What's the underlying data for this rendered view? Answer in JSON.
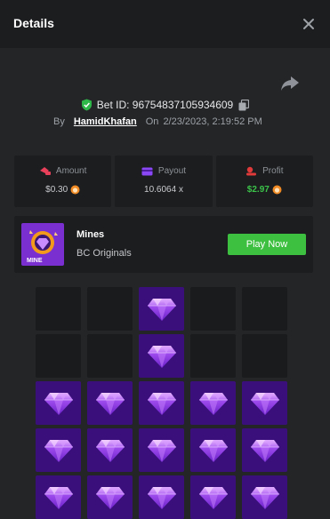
{
  "header": {
    "title": "Details"
  },
  "bet": {
    "id_text": "Bet ID: 96754837105934609",
    "by_label": "By",
    "username": "HamidKhafan",
    "on_label": "On",
    "datetime": "2/23/2023, 2:19:52 PM"
  },
  "stats": {
    "amount": {
      "label": "Amount",
      "value": "$0.30"
    },
    "payout": {
      "label": "Payout",
      "value": "10.6064 x"
    },
    "profit": {
      "label": "Profit",
      "value": "$2.97",
      "color": "#3cc34a"
    }
  },
  "game": {
    "thumb_label": "MINE",
    "name": "Mines",
    "provider": "BC Originals",
    "play_label": "Play Now"
  },
  "board": {
    "rows": [
      [
        "hidden",
        "hidden",
        "gem",
        "hidden",
        "hidden"
      ],
      [
        "hidden",
        "hidden",
        "gem",
        "hidden",
        "hidden"
      ],
      [
        "gem",
        "gem",
        "gem",
        "gem",
        "gem"
      ],
      [
        "gem",
        "gem",
        "gem",
        "gem",
        "gem"
      ],
      [
        "gem",
        "gem",
        "gem",
        "gem",
        "gem"
      ]
    ]
  },
  "colors": {
    "accent_green": "#3dbf3f",
    "gem_tile": "#3a0f7c",
    "empty_tile": "#191b1d",
    "amount_icon": "#e8405a",
    "payout_icon": "#8a47f5",
    "profit_icon": "#e03a3a"
  },
  "icons": [
    "close-icon",
    "share-icon",
    "shield-check-icon",
    "copy-icon",
    "coin-icon",
    "gem-icon"
  ]
}
